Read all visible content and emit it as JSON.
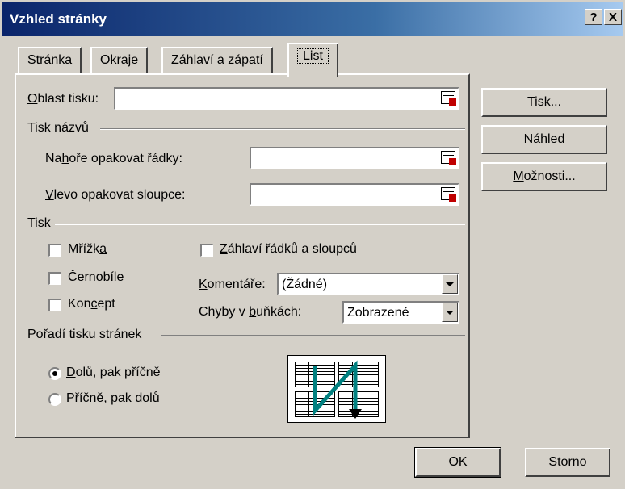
{
  "window": {
    "title": "Vzhled stránky",
    "help_btn": "?",
    "close_btn": "X"
  },
  "tabs": [
    {
      "label": "Stránka",
      "active": false
    },
    {
      "label": "Okraje",
      "active": false
    },
    {
      "label": "Záhlaví a zápatí",
      "active": false
    },
    {
      "label": "List",
      "active": true
    }
  ],
  "print_area": {
    "label_u": "O",
    "label_rest": "blast tisku:",
    "value": ""
  },
  "print_titles": {
    "section": "Tisk názvů",
    "rows_pre": "Na",
    "rows_u": "h",
    "rows_post": "oře opakovat řádky:",
    "rows_value": "",
    "cols_u": "V",
    "cols_post": "levo opakovat sloupce:",
    "cols_value": ""
  },
  "print": {
    "section": "Tisk",
    "gridlines_pre": "Mřížk",
    "gridlines_u": "a",
    "gridlines_checked": false,
    "bw_u": "Č",
    "bw_post": "ernobíle",
    "bw_checked": false,
    "draft_pre": "Kon",
    "draft_u": "c",
    "draft_post": "ept",
    "draft_checked": false,
    "headings_u": "Z",
    "headings_post": "áhlaví řádků a sloupců",
    "headings_checked": false,
    "comments_u": "K",
    "comments_post": "omentáře:",
    "comments_value": "(Žádné)",
    "errors_pre": "Chyby v ",
    "errors_u": "b",
    "errors_post": "uňkách:",
    "errors_value": "Zobrazené"
  },
  "page_order": {
    "section": "Pořadí tisku stránek",
    "down_u": "D",
    "down_post": "olů, pak příčně",
    "down_selected": true,
    "over_pre": "Příčně, pak dol",
    "over_u": "ů",
    "over_selected": false,
    "arrow_color": "#008080"
  },
  "buttons": {
    "print_u": "T",
    "print_post": "isk...",
    "preview_u": "N",
    "preview_post": "áhled",
    "options_u": "M",
    "options_post": "ožnosti...",
    "ok": "OK",
    "cancel": "Storno"
  }
}
